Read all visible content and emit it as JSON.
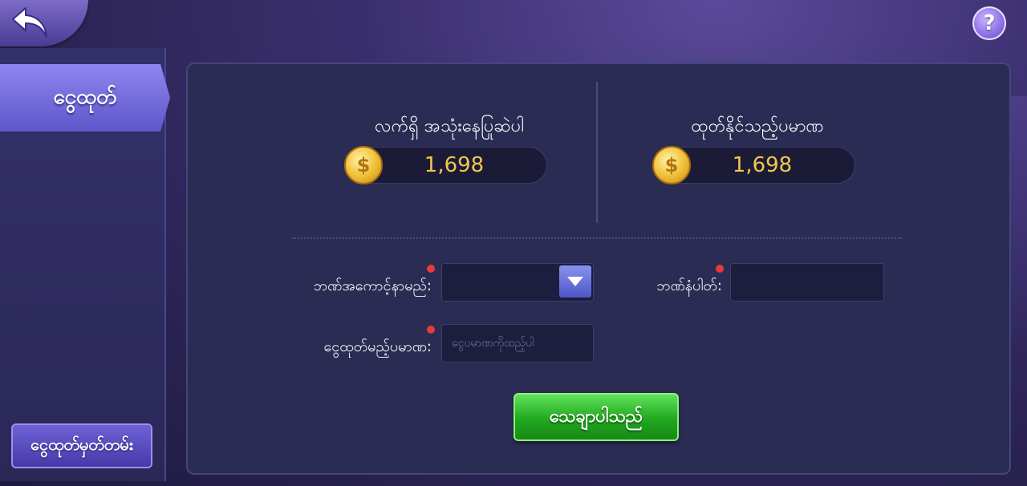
{
  "nav": {
    "back_icon": "back-arrow-icon",
    "help_label": "?"
  },
  "sidebar": {
    "active_tab": "ငွေထုတ်",
    "history_button": "ငွေထုတ်မှတ်တမ်း"
  },
  "balances": {
    "current": {
      "label": "လက်ရှိ အသုံးနေပြုဆဲပါ",
      "value": "1,698"
    },
    "withdrawable": {
      "label": "ထုတ်နိုင်သည့်ပမာဏ",
      "value": "1,698"
    },
    "coin_symbol": "$"
  },
  "form": {
    "bank_account_name_label": "ဘဏ်အကောင့်နာမည်:",
    "bank_number_label": "ဘဏ်နံပါတ်:",
    "amount_label": "ငွေထုတ်မည့်ပမာဏ:",
    "amount_placeholder": "ငွေပမာဏကိုထည့်ပါ",
    "confirm_button": "သေချာပါသည်"
  },
  "colors": {
    "accent_gold": "#f3c74a",
    "confirm_green": "#22a820",
    "required_red": "#e53b3b"
  }
}
